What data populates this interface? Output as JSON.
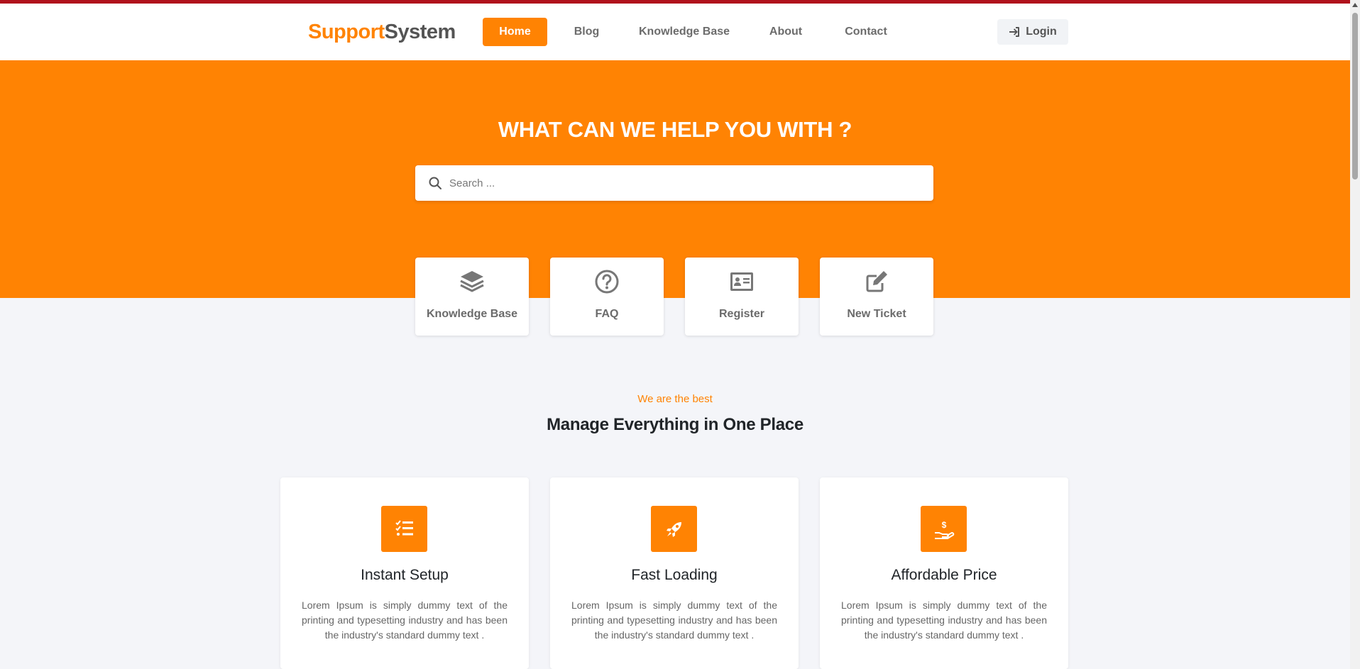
{
  "brand": {
    "part1": "Support",
    "part2": "System",
    "accent": "#ff8303"
  },
  "nav": {
    "items": [
      {
        "label": "Home",
        "active": true
      },
      {
        "label": "Blog",
        "active": false
      },
      {
        "label": "Knowledge Base",
        "active": false
      },
      {
        "label": "About",
        "active": false
      },
      {
        "label": "Contact",
        "active": false
      }
    ],
    "login_label": "Login",
    "login_icon": "sign-in-icon"
  },
  "hero": {
    "title": "WHAT CAN WE HELP YOU WITH ?",
    "search_placeholder": "Search ...",
    "search_value": ""
  },
  "quick_links": [
    {
      "label": "Knowledge Base",
      "icon": "layers-icon"
    },
    {
      "label": "FAQ",
      "icon": "question-circle-icon"
    },
    {
      "label": "Register",
      "icon": "id-card-icon"
    },
    {
      "label": "New Ticket",
      "icon": "edit-icon"
    }
  ],
  "section": {
    "tagline": "We are the best",
    "title": "Manage Everything in One Place"
  },
  "features": [
    {
      "title": "Instant Setup",
      "icon": "checklist-icon",
      "description": "Lorem Ipsum is simply dummy text of the printing and typesetting industry and has been the industry's standard dummy text ."
    },
    {
      "title": "Fast Loading",
      "icon": "rocket-icon",
      "description": "Lorem Ipsum is simply dummy text of the printing and typesetting industry and has been the industry's standard dummy text ."
    },
    {
      "title": "Affordable Price",
      "icon": "hand-dollar-icon",
      "description": "Lorem Ipsum is simply dummy text of the printing and typesetting industry and has been the industry's standard dummy text ."
    }
  ]
}
